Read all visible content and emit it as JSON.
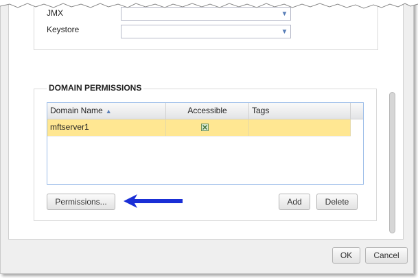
{
  "fields": {
    "jmx_label": "JMX",
    "keystore_label": "Keystore"
  },
  "domain_permissions": {
    "title": "DOMAIN PERMISSIONS",
    "columns": [
      "Domain Name",
      "Accessible",
      "Tags"
    ],
    "rows": [
      {
        "domain_name": "mftserver1",
        "accessible": true,
        "tags": ""
      }
    ],
    "permissions_button": "Permissions...",
    "add_button": "Add",
    "delete_button": "Delete"
  },
  "footer": {
    "ok_button": "OK",
    "cancel_button": "Cancel"
  },
  "colors": {
    "selected_row": "#ffe792",
    "arrow": "#1a2fd6",
    "grid_border": "#99bbe8"
  },
  "icons": {
    "combo_trigger": "chevron-down-icon",
    "sort": "sort-ascending-icon",
    "checkbox": "checked-box-icon",
    "pointer": "arrow-left-icon"
  }
}
